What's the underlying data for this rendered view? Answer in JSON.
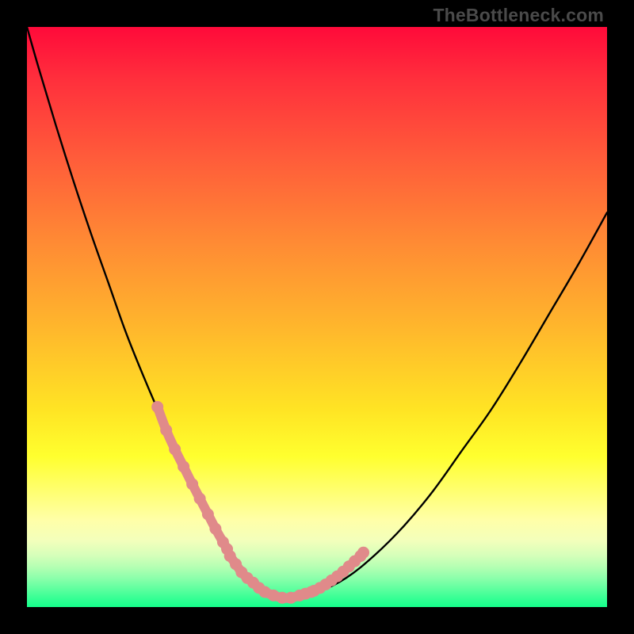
{
  "watermark": "TheBottleneck.com",
  "colors": {
    "curve_stroke": "#000000",
    "highlight_stroke": "#e08a8a",
    "highlight_fill": "#e08a8a"
  },
  "chart_data": {
    "type": "line",
    "title": "",
    "xlabel": "",
    "ylabel": "",
    "xlim": [
      0,
      100
    ],
    "ylim": [
      0,
      100
    ],
    "grid": false,
    "legend": false,
    "series": [
      {
        "name": "bottleneck-curve",
        "x": [
          0,
          2,
          5,
          8,
          11,
          14,
          17,
          20,
          23,
          26,
          29,
          31,
          33,
          35,
          36.5,
          38,
          39.5,
          41,
          43,
          46,
          50,
          55,
          60,
          65,
          70,
          75,
          80,
          85,
          90,
          95,
          100
        ],
        "y": [
          100,
          93,
          83,
          73.5,
          64.5,
          56,
          47.5,
          40,
          33,
          26.5,
          20.5,
          16.5,
          12.5,
          9.5,
          7,
          5,
          3.5,
          2.5,
          1.8,
          1.5,
          2.5,
          5,
          9,
          14,
          20,
          27,
          34,
          42,
          50.5,
          59,
          68
        ]
      }
    ],
    "highlight_segments": [
      {
        "name": "left-highlight",
        "x_range": [
          22.5,
          34.5
        ],
        "points_x": [
          22.5,
          24,
          25.5,
          27,
          28.5,
          29.8,
          31.2,
          32.5,
          33.8,
          34.5
        ],
        "points_y": [
          34.5,
          30.5,
          27.2,
          24.2,
          21.2,
          18.7,
          16,
          13.5,
          11.2,
          10
        ]
      },
      {
        "name": "bottom-highlight",
        "x_range": [
          35,
          49
        ],
        "points_x": [
          35,
          36,
          37,
          38,
          39,
          40,
          41,
          42.5,
          44,
          45.5,
          47,
          48,
          49
        ],
        "points_y": [
          8.8,
          7.4,
          6,
          5,
          4.2,
          3.3,
          2.6,
          2.0,
          1.6,
          1.6,
          2.0,
          2.3,
          2.6
        ]
      },
      {
        "name": "right-highlight",
        "x_range": [
          49,
          58
        ],
        "points_x": [
          49.5,
          50.5,
          51.5,
          52.5,
          53.5,
          54.5,
          55.5,
          56.5,
          57.5,
          58
        ],
        "points_y": [
          2.8,
          3.3,
          3.9,
          4.6,
          5.3,
          6.1,
          7.0,
          7.9,
          8.8,
          9.4
        ]
      }
    ]
  }
}
